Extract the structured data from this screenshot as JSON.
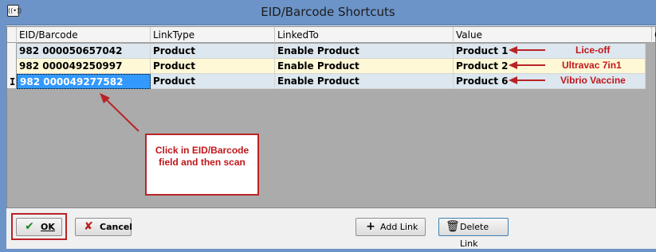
{
  "window": {
    "title": "EID/Barcode Shortcuts",
    "icon_label": "((•))"
  },
  "grid": {
    "columns": [
      {
        "label": "EID/Barcode"
      },
      {
        "label": "LinkType"
      },
      {
        "label": "LinkedTo"
      },
      {
        "label": "Value"
      },
      {
        "label": "C"
      }
    ],
    "rows": [
      {
        "eid": "982 000050657042",
        "linktype": "Product",
        "linkedto": "Enable Product",
        "value": "Product 1"
      },
      {
        "eid": "982 000049250997",
        "linktype": "Product",
        "linkedto": "Enable Product",
        "value": "Product 2"
      },
      {
        "eid": "982 000049277582",
        "linktype": "Product",
        "linkedto": "Enable Product",
        "value": "Product 6"
      }
    ],
    "current_row_marker": "I"
  },
  "annotations": {
    "row1_note": "Lice-off",
    "row2_note": "Ultravac 7in1",
    "row3_note": "Vibrio Vaccine",
    "callout_text": "Click in EID/Barcode field and then scan",
    "color": "#c0161a"
  },
  "buttons": {
    "ok": "OK",
    "cancel": "Cancel",
    "add_link": "Add Link",
    "delete_link": "Delete Link"
  }
}
